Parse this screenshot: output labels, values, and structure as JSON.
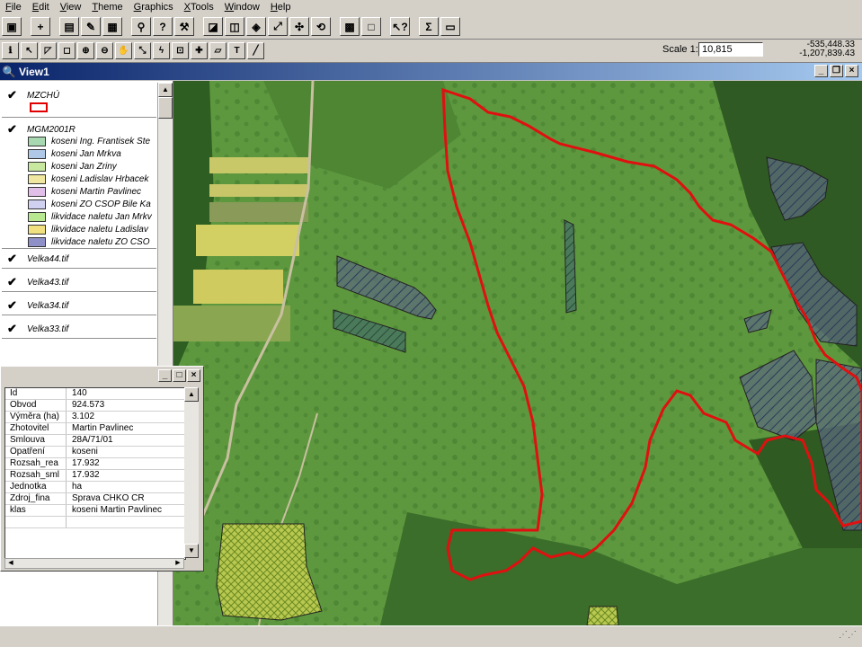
{
  "menu": [
    "File",
    "Edit",
    "View",
    "Theme",
    "Graphics",
    "XTools",
    "Window",
    "Help"
  ],
  "scale": {
    "label": "Scale 1:",
    "value": "10,815"
  },
  "coords": {
    "x": "-535,448.33",
    "y": "-1,207,839.43"
  },
  "view": {
    "title": "View1"
  },
  "toc": {
    "themes": [
      {
        "name": "MZCHÚ"
      },
      {
        "name": "MGM2001R"
      },
      {
        "name": "Velka44.tif"
      },
      {
        "name": "Velka43.tif"
      },
      {
        "name": "Velka34.tif"
      },
      {
        "name": "Velka33.tif"
      }
    ],
    "legend": [
      {
        "label": "koseni Ing. Frantisek Ste",
        "color": "#a8d8b0"
      },
      {
        "label": "koseni Jan Mrkva",
        "color": "#b0c8e8"
      },
      {
        "label": "koseni Jan Zriny",
        "color": "#c8e8a0"
      },
      {
        "label": "koseni Ladislav Hrbacek",
        "color": "#f0e8a0"
      },
      {
        "label": "koseni Martin Pavlinec",
        "color": "#e0c0e8"
      },
      {
        "label": "koseni ZO CSOP Bile Ka",
        "color": "#d0d0f0"
      },
      {
        "label": "likvidace naletu Jan Mrkv",
        "color": "#b8e890"
      },
      {
        "label": "likvidace naletu Ladislav",
        "color": "#f0e080"
      },
      {
        "label": "likvidace naletu ZO CSO",
        "color": "#9090c8"
      }
    ]
  },
  "identify": {
    "rows": [
      {
        "k": "Id",
        "v": "140"
      },
      {
        "k": "Obvod",
        "v": "924.573"
      },
      {
        "k": "Výměra (ha)",
        "v": "3.102"
      },
      {
        "k": "Zhotovitel",
        "v": "Martin Pavlinec"
      },
      {
        "k": "Smlouva",
        "v": "28A/71/01"
      },
      {
        "k": "Opatření",
        "v": "koseni"
      },
      {
        "k": "Rozsah_rea",
        "v": "17.932"
      },
      {
        "k": "Rozsah_sml",
        "v": "17.932"
      },
      {
        "k": "Jednotka",
        "v": "ha"
      },
      {
        "k": "Zdroj_fina",
        "v": "Sprava CHKO CR"
      },
      {
        "k": "klas",
        "v": "koseni Martin Pavlinec"
      }
    ]
  }
}
